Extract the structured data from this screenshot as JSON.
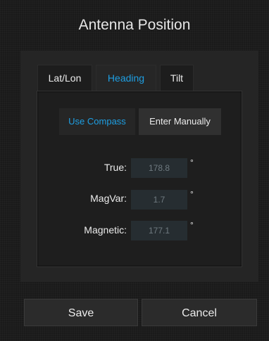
{
  "dialog": {
    "title": "Antenna Position"
  },
  "tabs": [
    {
      "label": "Lat/Lon",
      "active": false
    },
    {
      "label": "Heading",
      "active": true
    },
    {
      "label": "Tilt",
      "active": false
    }
  ],
  "mode_buttons": {
    "compass": "Use Compass",
    "manual": "Enter Manually",
    "active": "compass"
  },
  "fields": {
    "true_label": "True:",
    "true_value": "178.8",
    "magvar_label": "MagVar:",
    "magvar_value": "1.7",
    "magnetic_label": "Magnetic:",
    "magnetic_value": "177.1",
    "unit": "°"
  },
  "footer": {
    "save": "Save",
    "cancel": "Cancel"
  },
  "colors": {
    "accent": "#1e9fe3",
    "background": "#1a1a1a",
    "panel": "#252525"
  }
}
